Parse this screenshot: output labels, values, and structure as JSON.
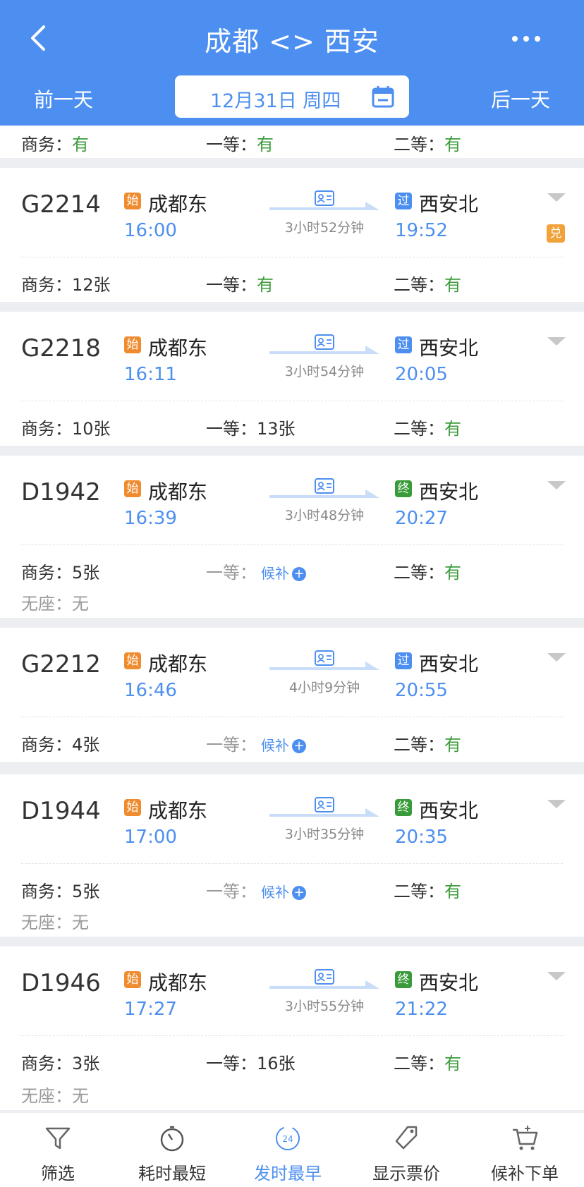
{
  "header": {
    "title": "成都 <> 西安",
    "prev_day": "前一天",
    "next_day": "后一天",
    "date": "12月31日 周四"
  },
  "summary": {
    "shangwu_label": "商务：",
    "shangwu_value": "有",
    "yideng_label": "一等：",
    "yideng_value": "有",
    "erdeng_label": "二等：",
    "erdeng_value": "有"
  },
  "labels": {
    "shangwu": "商务：",
    "yideng": "一等：",
    "erdeng": "二等：",
    "wuzuo": "无座：",
    "houbu": "候补",
    "start": "始",
    "pass": "过",
    "end": "终",
    "dui": "兑"
  },
  "trains": [
    {
      "no": "G2214",
      "from": "成都东",
      "dep": "16:00",
      "to": "西安北",
      "arr": "19:52",
      "duration": "3小时52分钟",
      "type": "pass",
      "shangwu": "12张",
      "yideng": "有",
      "erdeng": "有"
    },
    {
      "no": "G2218",
      "from": "成都东",
      "dep": "16:11",
      "to": "西安北",
      "arr": "20:05",
      "duration": "3小时54分钟",
      "type": "pass",
      "shangwu": "10张",
      "yideng": "13张",
      "erdeng": "有"
    },
    {
      "no": "D1942",
      "from": "成都东",
      "dep": "16:39",
      "to": "西安北",
      "arr": "20:27",
      "duration": "3小时48分钟",
      "type": "end",
      "shangwu": "5张",
      "erdeng": "有",
      "wuzuo": "无"
    },
    {
      "no": "G2212",
      "from": "成都东",
      "dep": "16:46",
      "to": "西安北",
      "arr": "20:55",
      "duration": "4小时9分钟",
      "type": "pass",
      "shangwu": "4张",
      "erdeng": "有"
    },
    {
      "no": "D1944",
      "from": "成都东",
      "dep": "17:00",
      "to": "西安北",
      "arr": "20:35",
      "duration": "3小时35分钟",
      "type": "end",
      "shangwu": "5张",
      "erdeng": "有",
      "wuzuo": "无"
    },
    {
      "no": "D1946",
      "from": "成都东",
      "dep": "17:27",
      "to": "西安北",
      "arr": "21:22",
      "duration": "3小时55分钟",
      "type": "end",
      "shangwu": "3张",
      "yideng": "16张",
      "erdeng": "有",
      "wuzuo": "无"
    }
  ],
  "tabbar": {
    "filter": "筛选",
    "shortest": "耗时最短",
    "earliest": "发时最早",
    "show_price": "显示票价",
    "waitlist": "候补下单",
    "clock_badge": "24"
  },
  "colors": {
    "primary": "#4d8ff0",
    "available": "#3a9b3a",
    "start_badge": "#f08c30"
  }
}
